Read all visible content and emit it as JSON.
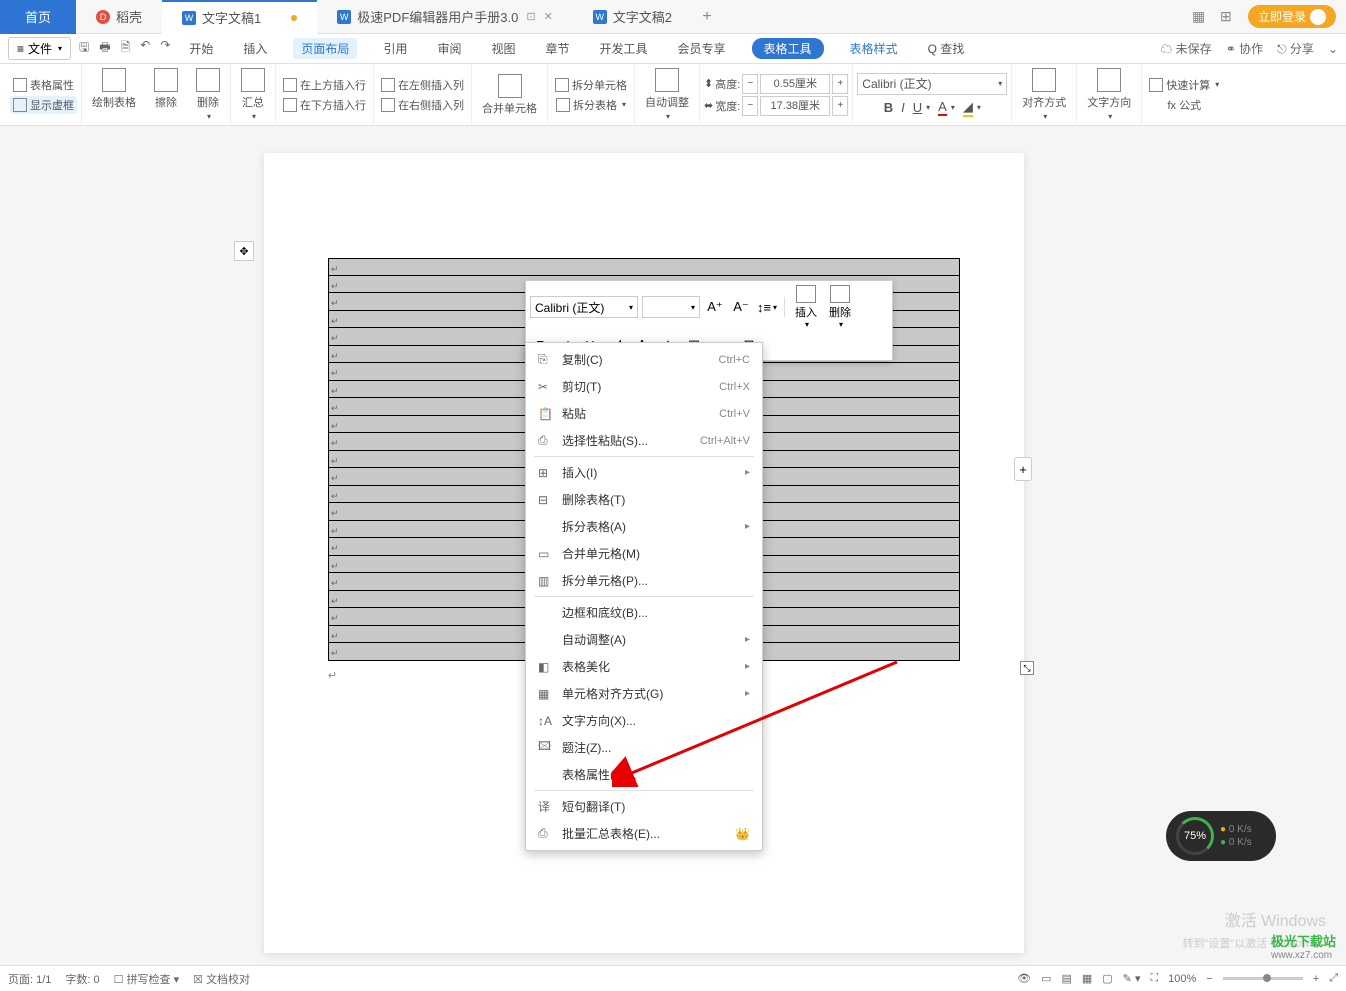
{
  "tabs": {
    "home": "首页",
    "docer": "稻壳",
    "doc1": "文字文稿1",
    "pdf": "极速PDF编辑器用户手册3.0",
    "doc2": "文字文稿2"
  },
  "login": "立即登录",
  "file_menu": "文件",
  "menu": {
    "start": "开始",
    "insert": "插入",
    "layout": "页面布局",
    "ref": "引用",
    "review": "审阅",
    "view": "视图",
    "chapter": "章节",
    "dev": "开发工具",
    "member": "会员专享",
    "table_tools": "表格工具",
    "table_style": "表格样式",
    "find": "Q 查找",
    "unsaved": "未保存",
    "collab": "协作",
    "share": "分享"
  },
  "ribbon": {
    "table_props": "表格属性",
    "show_grid": "显示虚框",
    "draw": "绘制表格",
    "erase": "擦除",
    "delete": "删除",
    "summary": "汇总",
    "ins_above": "在上方插入行",
    "ins_below": "在下方插入行",
    "ins_left": "在左侧插入列",
    "ins_right": "在右侧插入列",
    "merge": "合并单元格",
    "split_cell": "拆分单元格",
    "split_table": "拆分表格",
    "autofit": "自动调整",
    "height_lbl": "高度:",
    "width_lbl": "宽度:",
    "height_val": "0.55厘米",
    "width_val": "17.38厘米",
    "font": "Calibri (正文)",
    "align": "对齐方式",
    "direction": "文字方向",
    "fastcalc": "快速计算",
    "formula": "fx 公式"
  },
  "mini": {
    "font": "Calibri (正文)",
    "insert": "插入",
    "delete": "删除"
  },
  "ctx": {
    "copy": "复制(C)",
    "copy_k": "Ctrl+C",
    "cut": "剪切(T)",
    "cut_k": "Ctrl+X",
    "paste": "粘贴",
    "paste_k": "Ctrl+V",
    "paste_special": "选择性粘贴(S)...",
    "paste_special_k": "Ctrl+Alt+V",
    "insert": "插入(I)",
    "del_table": "删除表格(T)",
    "split_table": "拆分表格(A)",
    "merge_cell": "合并单元格(M)",
    "split_cell": "拆分单元格(P)...",
    "border": "边框和底纹(B)...",
    "autofit": "自动调整(A)",
    "beautify": "表格美化",
    "cell_align": "单元格对齐方式(G)",
    "text_dir": "文字方向(X)...",
    "caption": "题注(Z)...",
    "table_props": "表格属性(R)...",
    "translate": "短句翻译(T)",
    "batch_summary": "批量汇总表格(E)..."
  },
  "status": {
    "page": "页面: 1/1",
    "words": "字数: 0",
    "spell": "拼写检查",
    "proof": "文档校对",
    "zoom": "100%"
  },
  "watermark": {
    "title": "激活 Windows",
    "sub": "转到\"设置\"以激活 Windows。"
  },
  "site": {
    "name": "极光下载站",
    "url": "www.xz7.com"
  },
  "speed": {
    "pct": "75%",
    "up": "0 K/s",
    "dn": "0 K/s"
  },
  "table_rows": 23
}
